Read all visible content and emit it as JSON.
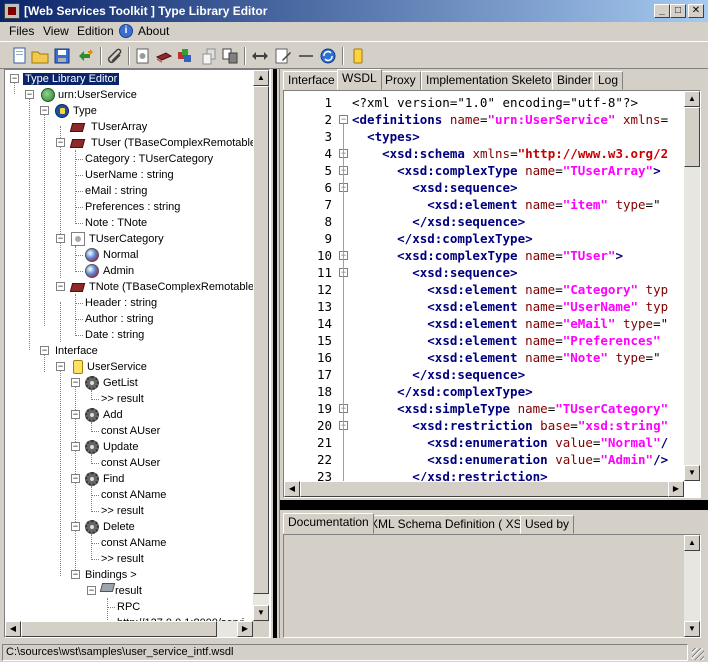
{
  "window": {
    "title": "[Web Services Toolkit ] Type Library Editor",
    "minimize": "_",
    "maximize": "□",
    "close": "✕"
  },
  "menu": [
    "Files",
    "View",
    "Edition",
    "About"
  ],
  "toolbar": {
    "icons": [
      "new-file-icon",
      "open-folder-icon",
      "save-icon",
      "refresh-arrows-icon",
      "clip-icon",
      "document-icon",
      "books-icon",
      "boxes-icon",
      "add-doc-icon",
      "compare-icon",
      "swap-icon",
      "edit-icon",
      "minus-icon",
      "sync-icon",
      "service-icon"
    ]
  },
  "tree": {
    "root": "Type Library Editor",
    "namespace": "urn:UserService",
    "type_group": "Type",
    "types": {
      "tuserarray": "TUserArray",
      "tuser": "TUser (TBaseComplexRemotable)",
      "tuser_fields": [
        "Category : TUserCategory",
        "UserName : string",
        "eMail : string",
        "Preferences : string",
        "Note : TNote"
      ],
      "tusercategory": "TUserCategory",
      "tusercategory_values": [
        "Normal",
        "Admin"
      ],
      "tnote": "TNote (TBaseComplexRemotable)",
      "tnote_fields": [
        "Header : string",
        "Author : string",
        "Date : string"
      ]
    },
    "interface_group": "Interface",
    "service": "UserService",
    "methods": {
      "getlist": "GetList",
      "getlist_result": ">> result",
      "add": "Add",
      "add_param": "const  AUser",
      "update": "Update",
      "update_param": "const  AUser",
      "find": "Find",
      "find_param": "const  AName",
      "find_result": ">> result",
      "delete": "Delete",
      "delete_param": "const  AName",
      "delete_result": ">> result"
    },
    "bindings": "Bindings >",
    "binding_name": "result",
    "rpc": "RPC",
    "address": "http://127.0.0.1:8000/servi"
  },
  "tabs": [
    "Interface",
    "WSDL",
    "Proxy",
    "Implementation Skeleton",
    "Binder",
    "Log"
  ],
  "active_tab": "WSDL",
  "code": {
    "line_numbers": [
      "1",
      "2",
      "3",
      "4",
      "5",
      "6",
      "7",
      "8",
      "9",
      "10",
      "11",
      "12",
      "13",
      "14",
      "15",
      "16",
      "17",
      "18",
      "19",
      "20",
      "21",
      "22",
      "23"
    ],
    "lines": [
      [
        [
          "pi",
          "<?xml version=\"1.0\" encoding=\"utf-8\"?>"
        ]
      ],
      [
        [
          "tag",
          "<definitions"
        ],
        [
          "txt",
          " "
        ],
        [
          "attr",
          "name"
        ],
        [
          "txt",
          "="
        ],
        [
          "str",
          "\"urn:UserService\""
        ],
        [
          "txt",
          " "
        ],
        [
          "attr",
          "xmlns"
        ],
        [
          "txt",
          "="
        ]
      ],
      [
        [
          "txt",
          "  "
        ],
        [
          "tag",
          "<types>"
        ]
      ],
      [
        [
          "txt",
          "    "
        ],
        [
          "tag",
          "<xsd:schema"
        ],
        [
          "txt",
          " "
        ],
        [
          "attr",
          "xmlns"
        ],
        [
          "txt",
          "="
        ],
        [
          "url",
          "\"http://www.w3.org/2"
        ]
      ],
      [
        [
          "txt",
          "      "
        ],
        [
          "tag",
          "<xsd:complexType"
        ],
        [
          "txt",
          " "
        ],
        [
          "attr",
          "name"
        ],
        [
          "txt",
          "="
        ],
        [
          "str",
          "\"TUserArray\""
        ],
        [
          "tag",
          ">"
        ]
      ],
      [
        [
          "txt",
          "        "
        ],
        [
          "tag",
          "<xsd:sequence>"
        ]
      ],
      [
        [
          "txt",
          "          "
        ],
        [
          "tag",
          "<xsd:element"
        ],
        [
          "txt",
          " "
        ],
        [
          "attr",
          "name"
        ],
        [
          "txt",
          "="
        ],
        [
          "str",
          "\"item\""
        ],
        [
          "txt",
          " "
        ],
        [
          "attr",
          "type"
        ],
        [
          "txt",
          "=\""
        ]
      ],
      [
        [
          "txt",
          "        "
        ],
        [
          "tag",
          "</xsd:sequence>"
        ]
      ],
      [
        [
          "txt",
          "      "
        ],
        [
          "tag",
          "</xsd:complexType>"
        ]
      ],
      [
        [
          "txt",
          "      "
        ],
        [
          "tag",
          "<xsd:complexType"
        ],
        [
          "txt",
          " "
        ],
        [
          "attr",
          "name"
        ],
        [
          "txt",
          "="
        ],
        [
          "str",
          "\"TUser\""
        ],
        [
          "tag",
          ">"
        ]
      ],
      [
        [
          "txt",
          "        "
        ],
        [
          "tag",
          "<xsd:sequence>"
        ]
      ],
      [
        [
          "txt",
          "          "
        ],
        [
          "tag",
          "<xsd:element"
        ],
        [
          "txt",
          " "
        ],
        [
          "attr",
          "name"
        ],
        [
          "txt",
          "="
        ],
        [
          "str",
          "\"Category\""
        ],
        [
          "txt",
          " "
        ],
        [
          "attr",
          "typ"
        ]
      ],
      [
        [
          "txt",
          "          "
        ],
        [
          "tag",
          "<xsd:element"
        ],
        [
          "txt",
          " "
        ],
        [
          "attr",
          "name"
        ],
        [
          "txt",
          "="
        ],
        [
          "str",
          "\"UserName\""
        ],
        [
          "txt",
          " "
        ],
        [
          "attr",
          "typ"
        ]
      ],
      [
        [
          "txt",
          "          "
        ],
        [
          "tag",
          "<xsd:element"
        ],
        [
          "txt",
          " "
        ],
        [
          "attr",
          "name"
        ],
        [
          "txt",
          "="
        ],
        [
          "str",
          "\"eMail\""
        ],
        [
          "txt",
          " "
        ],
        [
          "attr",
          "type"
        ],
        [
          "txt",
          "=\""
        ]
      ],
      [
        [
          "txt",
          "          "
        ],
        [
          "tag",
          "<xsd:element"
        ],
        [
          "txt",
          " "
        ],
        [
          "attr",
          "name"
        ],
        [
          "txt",
          "="
        ],
        [
          "str",
          "\"Preferences\""
        ],
        [
          "txt",
          " "
        ]
      ],
      [
        [
          "txt",
          "          "
        ],
        [
          "tag",
          "<xsd:element"
        ],
        [
          "txt",
          " "
        ],
        [
          "attr",
          "name"
        ],
        [
          "txt",
          "="
        ],
        [
          "str",
          "\"Note\""
        ],
        [
          "txt",
          " "
        ],
        [
          "attr",
          "type"
        ],
        [
          "txt",
          "=\""
        ]
      ],
      [
        [
          "txt",
          "        "
        ],
        [
          "tag",
          "</xsd:sequence>"
        ]
      ],
      [
        [
          "txt",
          "      "
        ],
        [
          "tag",
          "</xsd:complexType>"
        ]
      ],
      [
        [
          "txt",
          "      "
        ],
        [
          "tag",
          "<xsd:simpleType"
        ],
        [
          "txt",
          " "
        ],
        [
          "attr",
          "name"
        ],
        [
          "txt",
          "="
        ],
        [
          "str",
          "\"TUserCategory\""
        ]
      ],
      [
        [
          "txt",
          "        "
        ],
        [
          "tag",
          "<xsd:restriction"
        ],
        [
          "txt",
          " "
        ],
        [
          "attr",
          "base"
        ],
        [
          "txt",
          "="
        ],
        [
          "str",
          "\"xsd:string\""
        ]
      ],
      [
        [
          "txt",
          "          "
        ],
        [
          "tag",
          "<xsd:enumeration"
        ],
        [
          "txt",
          " "
        ],
        [
          "attr",
          "value"
        ],
        [
          "txt",
          "="
        ],
        [
          "str",
          "\"Normal\""
        ],
        [
          "tag",
          "/"
        ]
      ],
      [
        [
          "txt",
          "          "
        ],
        [
          "tag",
          "<xsd:enumeration"
        ],
        [
          "txt",
          " "
        ],
        [
          "attr",
          "value"
        ],
        [
          "txt",
          "="
        ],
        [
          "str",
          "\"Admin\""
        ],
        [
          "tag",
          "/>"
        ]
      ],
      [
        [
          "txt",
          "        "
        ],
        [
          "tag",
          "</xsd:restriction>"
        ]
      ]
    ]
  },
  "bottom_tabs": [
    "Documentation",
    "XML Schema Definition ( XSD )",
    "Used by"
  ],
  "active_bottom_tab": "Documentation",
  "status": "C:\\sources\\wst\\samples\\user_service_intf.wsdl"
}
